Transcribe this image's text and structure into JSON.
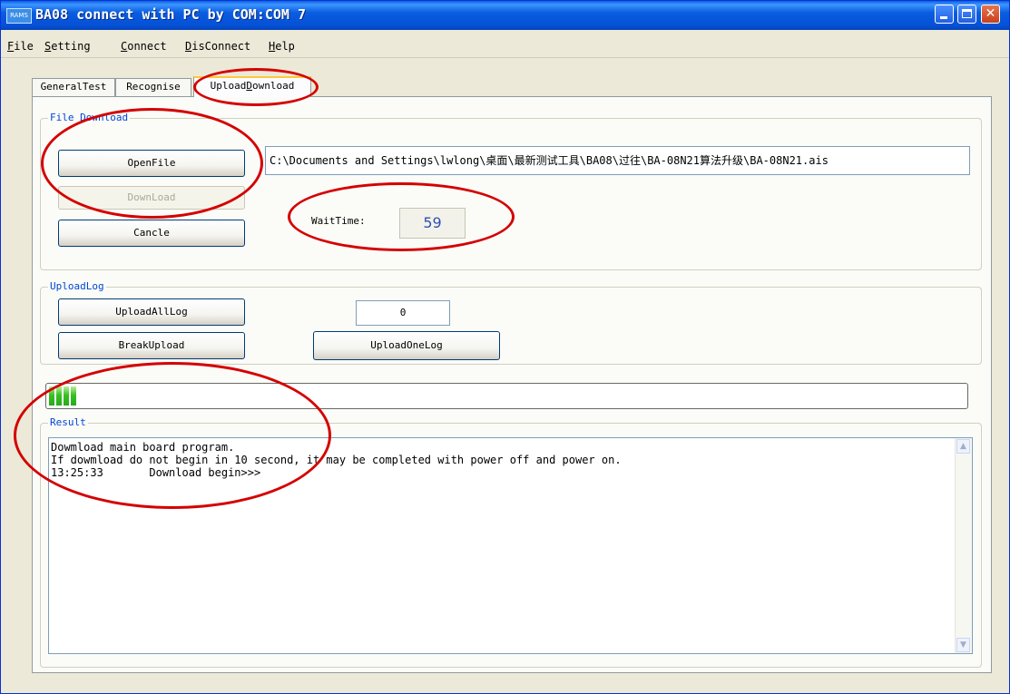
{
  "window": {
    "icon_text": "RAMS",
    "title": "BA08 connect with PC by COM:COM 7"
  },
  "menu": [
    {
      "key": "F",
      "rest": "ile"
    },
    {
      "key": "S",
      "rest": "etting"
    },
    {
      "key": "C",
      "rest": "onnect"
    },
    {
      "key": "D",
      "rest": "isConnect"
    },
    {
      "key": "H",
      "rest": "elp"
    }
  ],
  "tabs": [
    {
      "label": "GeneralTest",
      "active": false
    },
    {
      "label": "Recognise",
      "active": false
    },
    {
      "label_pre": "Upload",
      "label_key": "D",
      "label_post": "ownload",
      "active": true
    }
  ],
  "file_download": {
    "group_label": "File Download",
    "open_file_label": "OpenFile",
    "download_label": "DownLoad",
    "cancel_label": "Cancle",
    "file_path": "C:\\Documents and Settings\\lwlong\\桌面\\最新测试工具\\BA08\\过往\\BA-08N21算法升级\\BA-08N21.ais",
    "wait_time_label": "WaitTime:",
    "wait_time_value": "59"
  },
  "upload_log": {
    "group_label": "UploadLog",
    "upload_all_label": "UploadAllLog",
    "log_number": "0",
    "break_upload_label": "BreakUpload",
    "upload_one_label": "UploadOneLog"
  },
  "progress": {
    "filled_blocks": 4
  },
  "result": {
    "group_label": "Result",
    "lines": [
      "Dowmload main board program.",
      "If dowmload do not begin in 10 second, it may be completed with power off and power on.",
      "13:25:33       Download begin>>>"
    ]
  },
  "colors": {
    "title_bar": "#0a5ee0",
    "group_label": "#0046d5",
    "annotation_ellipse": "#d40000",
    "progress_fill": "#39c025"
  }
}
